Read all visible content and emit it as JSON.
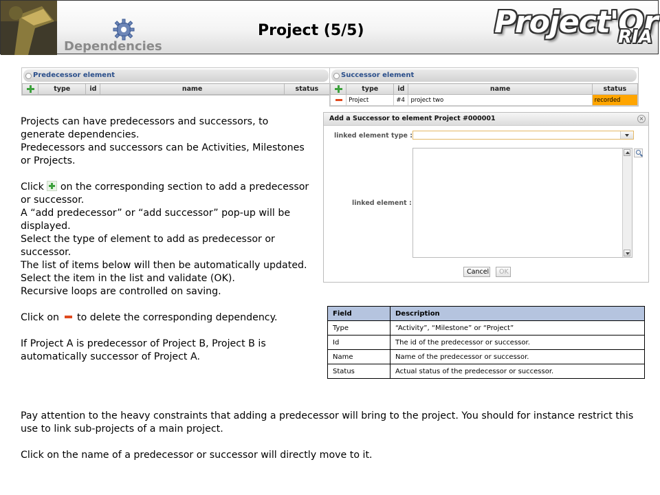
{
  "header": {
    "section": "Dependencies",
    "title": "Project (5/5)",
    "brand": "Project'Or",
    "brand_sub": "RIA"
  },
  "predecessor_panel": {
    "title": "Predecessor element",
    "columns": [
      "type",
      "id",
      "name",
      "status"
    ],
    "rows": []
  },
  "successor_panel": {
    "title": "Successor element",
    "columns": [
      "type",
      "id",
      "name",
      "status"
    ],
    "rows": [
      {
        "type": "Project",
        "id": "#4",
        "name": "project two",
        "status": "recorded"
      }
    ],
    "status_color": "#ffa500"
  },
  "description": {
    "p1": "Projects can have predecessors and successors, to generate dependencies.",
    "p2": "Predecessors and successors can be Activities, Milestones or Projects.",
    "click_prefix": "Click",
    "click_suffix": "on the corresponding section to add a predecessor or successor.",
    "p4": "A “add predecessor” or “add successor” pop-up will be displayed.",
    "p5": "Select the type of element to add as predecessor or successor.",
    "p6": "The list of items below will then be automatically updated.",
    "p7": "Select the item in the list and validate (OK).",
    "p8": "Recursive loops are controlled on saving.",
    "delete_prefix": "Click on",
    "delete_suffix": "to delete the corresponding dependency.",
    "p10": "If Project A is predecessor of Project B, Project B is automatically successor of Project A."
  },
  "bottom": {
    "p1": "Pay attention to the heavy constraints that adding a predecessor will bring to the project. You should for instance restrict this use to link sub-projects of a main project.",
    "p2": "Click on the name of a predecessor or successor will directly move to it."
  },
  "dialog": {
    "title": "Add a Successor to element Project #000001",
    "type_label": "linked element type :",
    "type_value": "",
    "element_label": "linked element :",
    "cancel": "Cancel",
    "ok": "OK"
  },
  "field_table": {
    "headers": [
      "Field",
      "Description"
    ],
    "rows": [
      [
        "Type",
        "“Activity”, “Milestone” or “Project”"
      ],
      [
        "Id",
        "The id of the predecessor or successor."
      ],
      [
        "Name",
        "Name of the predecessor or successor."
      ],
      [
        "Status",
        "Actual status of the predecessor or successor."
      ]
    ],
    "header_color": "#b5c4df"
  }
}
